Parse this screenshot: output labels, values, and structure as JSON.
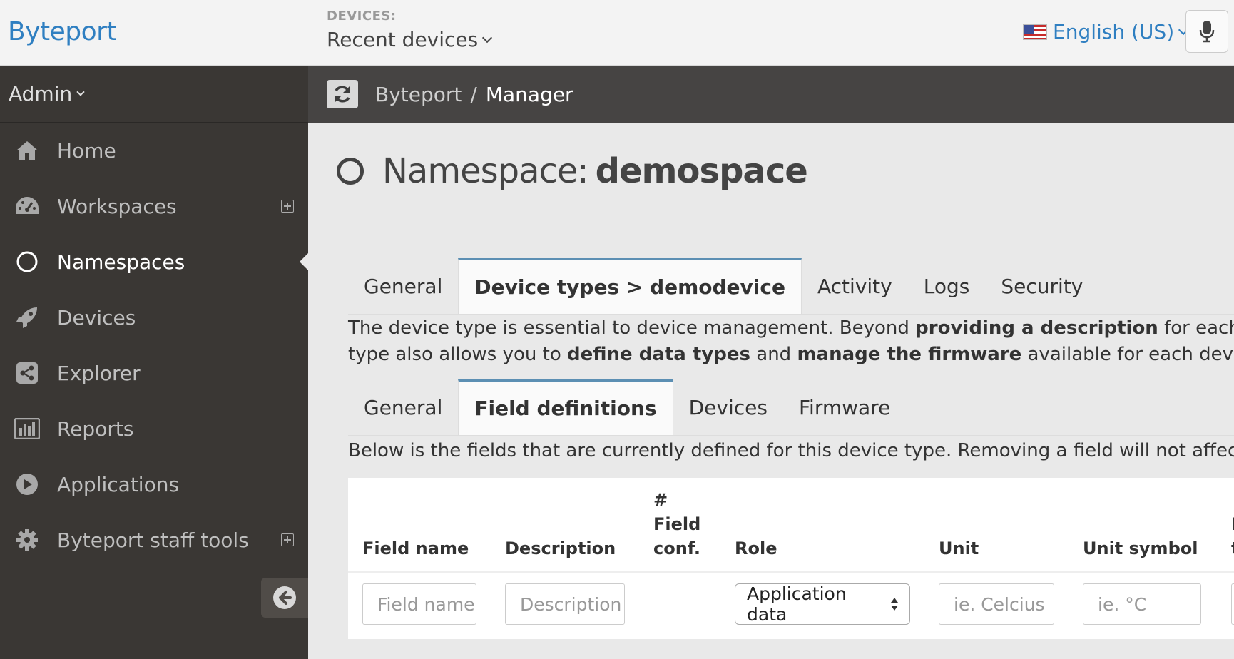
{
  "topbar": {
    "brand": "Byteport",
    "devices_label": "DEVICES:",
    "devices_select": "Recent devices",
    "language": "English (US)"
  },
  "sidebar": {
    "user": "Admin",
    "items": [
      {
        "label": "Home",
        "icon": "home-icon"
      },
      {
        "label": "Workspaces",
        "icon": "dashboard-icon"
      },
      {
        "label": "Namespaces",
        "icon": "circle-icon"
      },
      {
        "label": "Devices",
        "icon": "rocket-icon"
      },
      {
        "label": "Explorer",
        "icon": "share-icon"
      },
      {
        "label": "Reports",
        "icon": "bar-chart-icon"
      },
      {
        "label": "Applications",
        "icon": "play-icon"
      },
      {
        "label": "Byteport staff tools",
        "icon": "gear-icon"
      }
    ]
  },
  "breadcrumb": {
    "root": "Byteport",
    "separator": "/",
    "current": "Manager"
  },
  "page": {
    "title_prefix": "Namespace:",
    "title_name": "demospace"
  },
  "tabs_main": [
    "General",
    "Device types > demodevice",
    "Activity",
    "Logs",
    "Security"
  ],
  "device_type_desc": {
    "p1": "The device type is essential to device management. Beyond ",
    "b1": "providing a description",
    "p2": " for each device ab",
    "p3": "type also allows you to ",
    "b2": "define data types",
    "p4": " and ",
    "b3": "manage the firmware",
    "p5": " available for each device."
  },
  "tabs_sub": [
    "General",
    "Field definitions",
    "Devices",
    "Firmware"
  ],
  "fields_desc": "Below is the fields that are currently defined for this device type. Removing a field will not affect already",
  "table": {
    "headers": {
      "field_name": "Field name",
      "description": "Description",
      "field_conf_1": "#",
      "field_conf_2": "Field",
      "field_conf_3": "conf.",
      "role": "Role",
      "unit": "Unit",
      "unit_symbol": "Unit symbol",
      "cut_1": "I",
      "cut_2": "t"
    },
    "inputs": {
      "field_name_placeholder": "Field name",
      "description_placeholder": "Description",
      "role_value": "Application data",
      "unit_placeholder": "ie. Celcius",
      "unit_symbol_placeholder": "ie. °C"
    }
  },
  "colors": {
    "brand": "#2f7fc1",
    "sidebar_bg": "#3a3734",
    "crumbbar_bg": "#464443",
    "tab_accent": "#5c8fb3"
  }
}
